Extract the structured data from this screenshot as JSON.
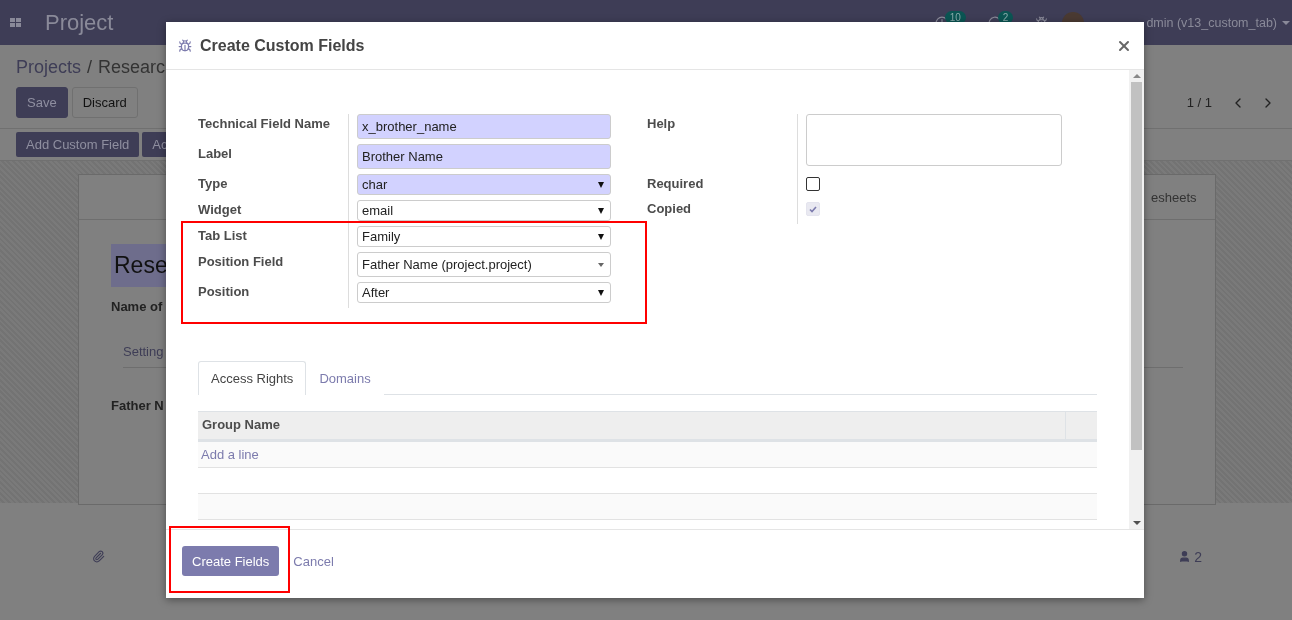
{
  "navbar": {
    "app_title": "Project",
    "activity_count": "10",
    "message_count": "2",
    "user": "dmin (v13_custom_tab)"
  },
  "breadcrumb": {
    "items": [
      "Projects",
      "Researc"
    ],
    "separator": "/"
  },
  "form_buttons": [
    "Save",
    "Discard"
  ],
  "pager": "1 / 1",
  "action_buttons": [
    "Add Custom Field",
    "Ac"
  ],
  "record": {
    "title": "Rese",
    "name_label": "Name of",
    "smart_button": "esheets",
    "tab": "Setting",
    "field_label": "Father N",
    "followers": "2"
  },
  "dialog": {
    "title": "Create Custom Fields",
    "left_groups": [
      {
        "fields": [
          {
            "label": "Technical Field Name",
            "kind": "input",
            "value": "x_brother_name",
            "required": true
          },
          {
            "label": "Label",
            "kind": "input",
            "value": "Brother Name",
            "required": true
          },
          {
            "label": "Type",
            "kind": "select",
            "value": "char",
            "required": true
          },
          {
            "label": "Widget",
            "kind": "select",
            "value": "email",
            "required": false
          }
        ]
      },
      {
        "highlighted": true,
        "fields": [
          {
            "label": "Tab List",
            "kind": "select",
            "value": "Family",
            "required": false
          },
          {
            "label": "Position Field",
            "kind": "many2one",
            "value": "Father Name (project.project)",
            "required": false
          },
          {
            "label": "Position",
            "kind": "select",
            "value": "After",
            "required": false
          }
        ]
      }
    ],
    "right_fields": [
      {
        "label": "Help",
        "kind": "textarea"
      },
      {
        "label": "Required",
        "kind": "checkbox",
        "checked": false
      },
      {
        "label": "Copied",
        "kind": "checkbox",
        "checked": true
      }
    ],
    "tabs": [
      {
        "label": "Access Rights",
        "selected": true
      },
      {
        "label": "Domains",
        "selected": false
      }
    ],
    "table": {
      "columns": [
        "Group Name"
      ],
      "add_line": "Add a line"
    },
    "footer": {
      "primary": "Create Fields",
      "primary_highlighted": true,
      "cancel": "Cancel"
    }
  }
}
